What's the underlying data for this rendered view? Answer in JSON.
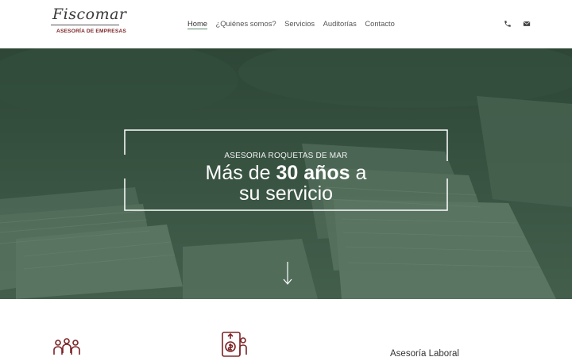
{
  "brand": {
    "name": "Fiscomar",
    "tagline": "ASESORÍA DE EMPRESAS",
    "accent_color": "#7c2326"
  },
  "nav": {
    "items": [
      {
        "label": "Home",
        "active": true
      },
      {
        "label": "¿Quiénes somos?",
        "active": false
      },
      {
        "label": "Servicios",
        "active": false
      },
      {
        "label": "Auditorías",
        "active": false
      },
      {
        "label": "Contacto",
        "active": false
      }
    ],
    "icons": [
      "phone-icon",
      "email-icon"
    ]
  },
  "hero": {
    "subtitle": "ASESORIA ROQUETAS DE MAR",
    "title_pre": "Más de ",
    "title_bold": "30 años",
    "title_post": " a",
    "title_line2": "su servicio",
    "overlay_color": "#3f5a47"
  },
  "services": {
    "icons": [
      "team-icon",
      "finance-growth-icon"
    ],
    "visible_label": "Asesoría Laboral"
  }
}
